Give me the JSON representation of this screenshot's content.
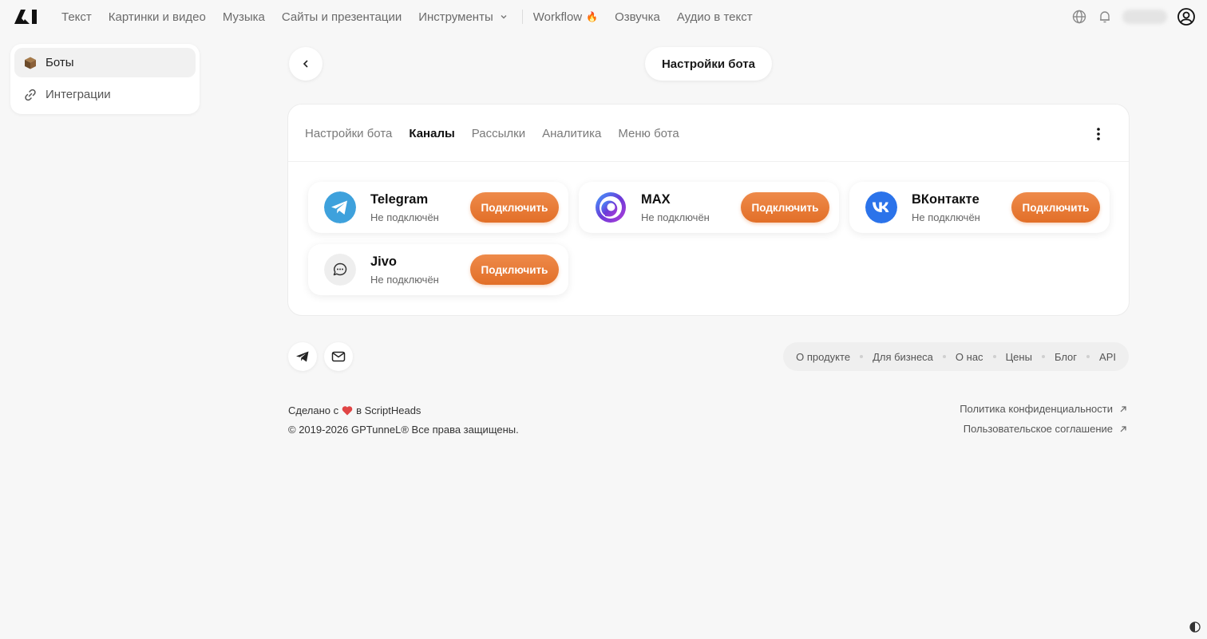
{
  "nav": {
    "items": [
      "Текст",
      "Картинки и видео",
      "Музыка",
      "Сайты и презентации",
      "Инструменты"
    ],
    "items2": [
      "Workflow",
      "Озвучка",
      "Аудио в текст"
    ],
    "fire": "🔥"
  },
  "sidebar": {
    "items": [
      {
        "label": "Боты",
        "icon": "box-icon"
      },
      {
        "label": "Интеграции",
        "icon": "link-icon"
      }
    ]
  },
  "header": {
    "title": "Настройки бота"
  },
  "tabs": [
    "Настройки бота",
    "Каналы",
    "Рассылки",
    "Аналитика",
    "Меню бота"
  ],
  "active_tab": "Каналы",
  "channels": [
    {
      "name": "Telegram",
      "status": "Не подключён",
      "button": "Подключить",
      "icon": "telegram-icon"
    },
    {
      "name": "MAX",
      "status": "Не подключён",
      "button": "Подключить",
      "icon": "max-icon"
    },
    {
      "name": "ВКонтакте",
      "status": "Не подключён",
      "button": "Подключить",
      "icon": "vk-icon"
    },
    {
      "name": "Jivo",
      "status": "Не подключён",
      "button": "Подключить",
      "icon": "jivo-icon"
    }
  ],
  "footer": {
    "links": [
      "О продукте",
      "Для бизнеса",
      "О нас",
      "Цены",
      "Блог",
      "API"
    ],
    "made_prefix": "Сделано с",
    "made_suffix": "в ScriptHeads",
    "copyright": "© 2019-2026 GPTunneL® Все права защищены.",
    "privacy": "Политика конфиденциальности",
    "terms": "Пользовательское соглашение"
  },
  "colors": {
    "accent": "#e8792f",
    "telegram": "#3ea1dc",
    "vk": "#2b73ea",
    "max": "#5b3fd6"
  }
}
